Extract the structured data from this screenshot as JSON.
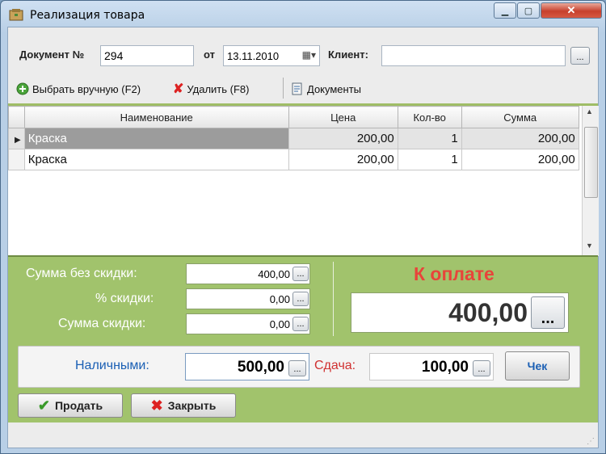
{
  "window": {
    "title": "Реализация товара",
    "minimize_icon": "minimize-icon",
    "maximize_icon": "maximize-icon",
    "close_icon": "close-icon"
  },
  "header": {
    "doc_label": "Документ №",
    "doc_number": "294",
    "from_label": "от",
    "date": "13.11.2010",
    "client_label": "Клиент:",
    "client_value": "",
    "ellipsis": "..."
  },
  "toolbar": {
    "select_label": "Выбрать вручную (F2)",
    "delete_label": "Удалить (F8)",
    "documents_label": "Документы"
  },
  "grid": {
    "columns": [
      "Наименование",
      "Цена",
      "Кол-во",
      "Сумма"
    ],
    "rows": [
      {
        "name": "Краска",
        "price": "200,00",
        "qty": "1",
        "sum": "200,00"
      },
      {
        "name": "Краска",
        "price": "200,00",
        "qty": "1",
        "sum": "200,00"
      }
    ]
  },
  "totals": {
    "sum_no_discount_label": "Сумма без скидки:",
    "sum_no_discount": "400,00",
    "discount_pct_label": "% скидки:",
    "discount_pct": "0,00",
    "discount_sum_label": "Сумма скидки:",
    "discount_sum": "0,00",
    "to_pay_label": "К оплате",
    "to_pay": "400,00"
  },
  "payment": {
    "cash_label": "Наличными:",
    "cash": "500,00",
    "change_label": "Сдача:",
    "change": "100,00",
    "receipt_button": "Чек"
  },
  "actions": {
    "sell_button": "Продать",
    "close_button": "Закрыть"
  },
  "colors": {
    "accent_green": "#a1c36c",
    "to_pay_red": "#e8443a",
    "cash_blue": "#1a5fb4",
    "change_red": "#d03030"
  }
}
